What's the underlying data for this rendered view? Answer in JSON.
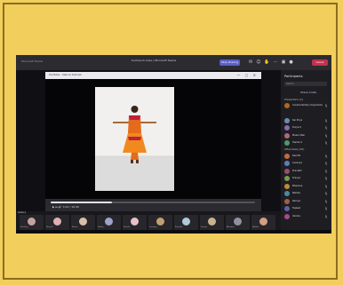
{
  "window": {
    "app": "Microsoft Teams",
    "title": "Kuchipudi class | Microsoft Teams",
    "share_button": "Stop sharing",
    "leave_button": "Leave"
  },
  "browser": {
    "tab_title": "YouTube - Dance tutorial",
    "controls": "▶  ⏭  🔊  3:12 / 10:45"
  },
  "video": {
    "progress": 0.3
  },
  "panel": {
    "title": "Participants",
    "search_placeholder": "Search",
    "share_link": "Share invite",
    "section_presenters": "Presenters (1)",
    "section_attendees": "Attendees (16)",
    "participants": [
      {
        "name": "Anusha Reddy (Organizer)",
        "color": "#b5651d"
      },
      {
        "name": "Sai Priya",
        "color": "#6a8caf"
      },
      {
        "name": "Divya K",
        "color": "#8c6aaf"
      },
      {
        "name": "Meera Nair",
        "color": "#af6a7a"
      },
      {
        "name": "Harika S",
        "color": "#4f9a6a"
      },
      {
        "name": "Keerthi",
        "color": "#c46b3c"
      },
      {
        "name": "Lavanya",
        "color": "#5a7fbf"
      },
      {
        "name": "Pranathi",
        "color": "#9a4f6a"
      },
      {
        "name": "Sravya",
        "color": "#7a9a4f"
      },
      {
        "name": "Bhavana",
        "color": "#bf8a3a"
      },
      {
        "name": "Nikhila",
        "color": "#4a8aa0"
      },
      {
        "name": "Ramya",
        "color": "#a06040"
      },
      {
        "name": "Tejaswi",
        "color": "#6060a8"
      },
      {
        "name": "Varsha",
        "color": "#a84a8a"
      }
    ]
  },
  "strip": {
    "label": "Gallery",
    "tiles": [
      {
        "name": "Sai Priya",
        "color": "#c9a0a0"
      },
      {
        "name": "Divya K",
        "color": "#e0b0b0"
      },
      {
        "name": "Meera",
        "color": "#d8c0a8"
      },
      {
        "name": "Harika",
        "color": "#a0a0c8"
      },
      {
        "name": "Keerthi",
        "color": "#e8c0c8"
      },
      {
        "name": "Lavanya",
        "color": "#c0a070"
      },
      {
        "name": "Pranathi",
        "color": "#b0c8d8"
      },
      {
        "name": "Sravya",
        "color": "#c8b090"
      },
      {
        "name": "Bhavana",
        "color": "#9090a0"
      },
      {
        "name": "Nikhila",
        "color": "#d0a080"
      }
    ]
  }
}
